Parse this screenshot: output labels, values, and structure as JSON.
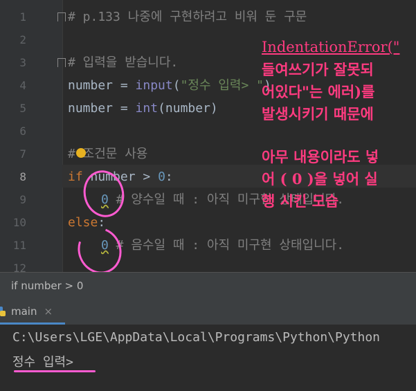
{
  "editor": {
    "line_numbers": [
      "1",
      "2",
      "3",
      "4",
      "5",
      "6",
      "7",
      "8",
      "9",
      "10",
      "11",
      "12"
    ],
    "current_line": "8",
    "lines": {
      "l1": "# p.133 나중에 구현하려고 비워 둔 구문",
      "l3": "# 입력을 받습니다.",
      "l4_var": "number",
      "l4_eq": " = ",
      "l4_fn": "input",
      "l4_open": "(",
      "l4_str": "\"정수 입력> \"",
      "l4_close": ")",
      "l5_var": "number",
      "l5_eq": " = ",
      "l5_fn": "int",
      "l5_rest": "(number)",
      "l7": "# 조건문 사용",
      "l8_kw": "if",
      "l8_mid": " number > ",
      "l8_num": "0",
      "l8_colon": ":",
      "l9_num": "0",
      "l9_cm": " # 양수일 때 : 아직 미구현 상태입니다.",
      "l10_kw": "else",
      "l10_colon": ":",
      "l11_num": "0",
      "l11_cm": " # 음수일 때 : 아직 미구현 상태입니다."
    }
  },
  "annotation": {
    "line1": "IndentationError(\"",
    "line2": "들여쓰기가 잘못되",
    "line3": "어있다\"는 에러)를",
    "line4": "발생시키기 때문에",
    "line5": "아무 내용이라도 넣",
    "line6": "어 ( 0 )을 넣어 실",
    "line7": "행 시킨 모습"
  },
  "breadcrumb": {
    "text": "if number > 0"
  },
  "run": {
    "tab_label": "main",
    "tab_close": "×"
  },
  "console": {
    "path_line": "C:\\Users\\LGE\\AppData\\Local\\Programs\\Python\\Python",
    "prompt_line": "정수 입력>"
  },
  "colors": {
    "annotation_pink": "#ff3b80",
    "marker_pink": "#ff5bd1",
    "background": "#2b2b2b"
  }
}
